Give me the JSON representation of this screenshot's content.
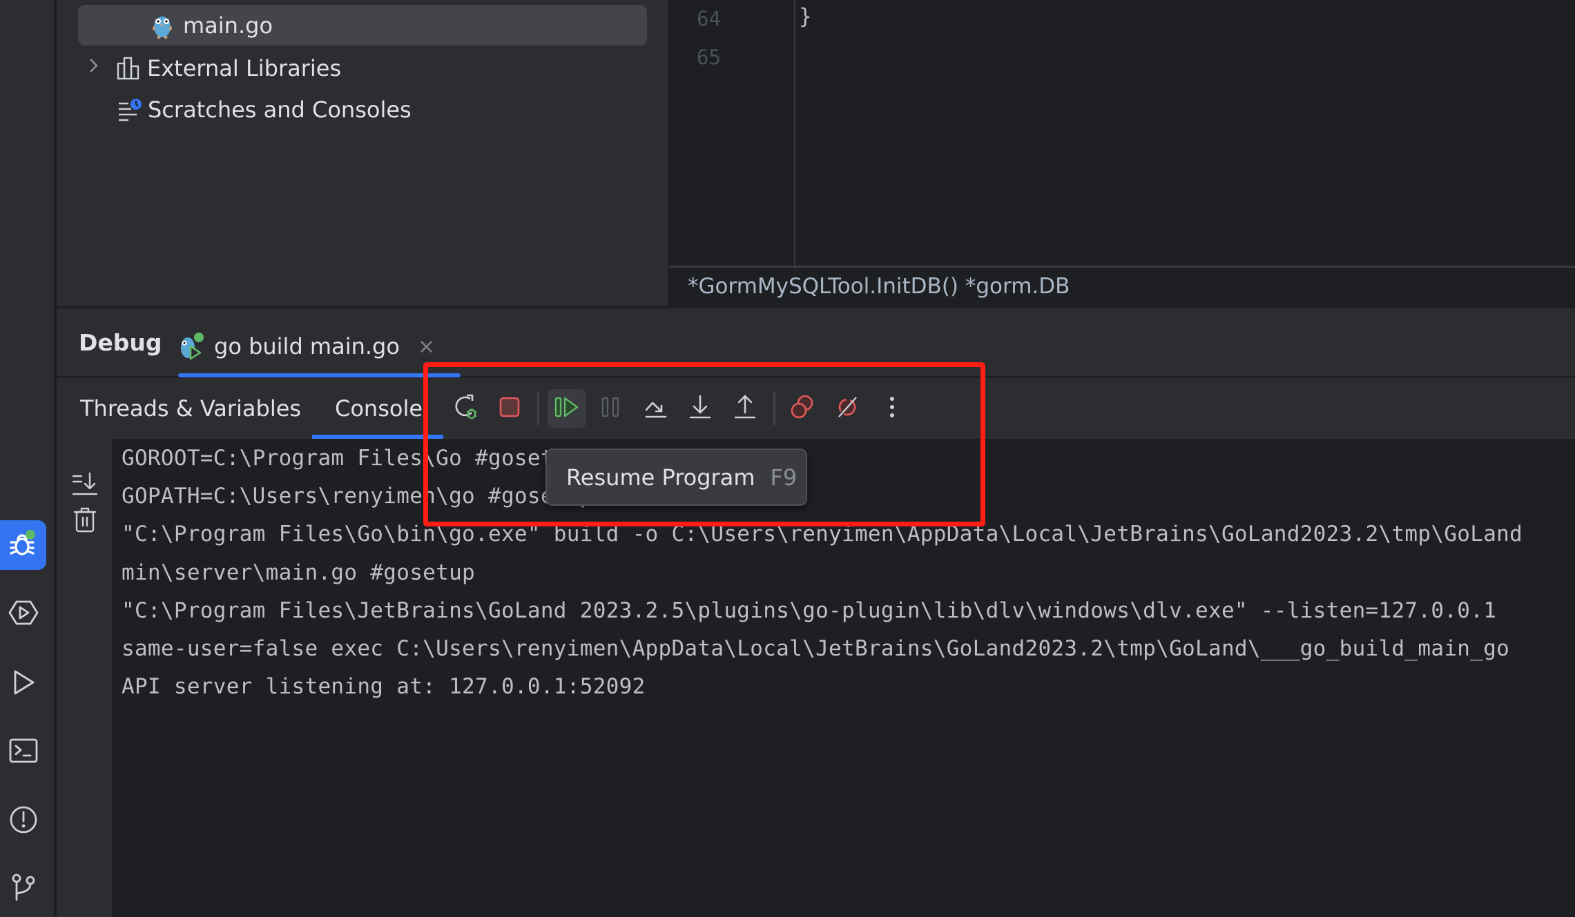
{
  "project_tree": {
    "items": [
      {
        "label": "main.go",
        "icon": "go-gopher-file-icon",
        "selected": true
      },
      {
        "label": "External Libraries",
        "icon": "library-icon",
        "expandable": true
      },
      {
        "label": "Scratches and Consoles",
        "icon": "scratches-icon"
      }
    ]
  },
  "editor": {
    "line_numbers": [
      "64",
      "65"
    ],
    "code_lines": [
      "}"
    ],
    "breadcrumb": "*GormMySQLTool.InitDB() *gorm.DB"
  },
  "left_strip": {
    "items": [
      {
        "name": "debug",
        "icon": "bug-icon",
        "active": true,
        "badge_color": "#5fb865"
      },
      {
        "name": "services",
        "icon": "services-icon"
      },
      {
        "name": "run",
        "icon": "run-icon"
      },
      {
        "name": "terminal",
        "icon": "terminal-icon"
      },
      {
        "name": "problems",
        "icon": "problems-icon"
      },
      {
        "name": "git",
        "icon": "git-branch-icon"
      }
    ]
  },
  "debug_window": {
    "title": "Debug",
    "run_tab": {
      "label": "go build main.go",
      "close": "×"
    },
    "subtabs": [
      {
        "label": "Threads & Variables",
        "active": false
      },
      {
        "label": "Console",
        "active": true
      }
    ],
    "toolbar": [
      {
        "name": "rerun",
        "icon": "rerun-debug-icon"
      },
      {
        "name": "stop",
        "icon": "stop-icon"
      },
      {
        "name": "resume",
        "icon": "resume-program-icon",
        "hovered": true
      },
      {
        "name": "pause",
        "icon": "pause-icon",
        "enabled": false
      },
      {
        "name": "step-over",
        "icon": "step-over-icon"
      },
      {
        "name": "step-into",
        "icon": "step-into-icon"
      },
      {
        "name": "step-out",
        "icon": "step-out-icon"
      },
      {
        "name": "view-breakpoints",
        "icon": "view-breakpoints-icon"
      },
      {
        "name": "mute-breakpoints",
        "icon": "mute-breakpoints-icon"
      },
      {
        "name": "more",
        "icon": "more-vertical-icon"
      }
    ],
    "tooltip": {
      "label": "Resume Program",
      "shortcut": "F9"
    }
  },
  "console": {
    "gutter": [
      {
        "name": "scroll-to-end",
        "icon": "scroll-to-end-icon"
      },
      {
        "name": "clear-all",
        "icon": "trash-icon"
      }
    ],
    "lines": [
      "GOROOT=C:\\Program Files\\Go #gosetup",
      "GOPATH=C:\\Users\\renyimen\\go #gosetup",
      "\"C:\\Program Files\\Go\\bin\\go.exe\" build -o C:\\Users\\renyimen\\AppData\\Local\\JetBrains\\GoLand2023.2\\tmp\\GoLand",
      "min\\server\\main.go #gosetup",
      "\"C:\\Program Files\\JetBrains\\GoLand 2023.2.5\\plugins\\go-plugin\\lib\\dlv\\windows\\dlv.exe\" --listen=127.0.0.1",
      "same-user=false exec C:\\Users\\renyimen\\AppData\\Local\\JetBrains\\GoLand2023.2\\tmp\\GoLand\\___go_build_main_go",
      "API server listening at: 127.0.0.1:52092"
    ]
  },
  "colors": {
    "accent": "#3574f0",
    "annotation_box": "#ff1d14",
    "resume_green": "#5fb865",
    "stop_red": "#e5585a",
    "panel_bg": "#2b2d30",
    "editor_bg": "#1e1f22"
  }
}
